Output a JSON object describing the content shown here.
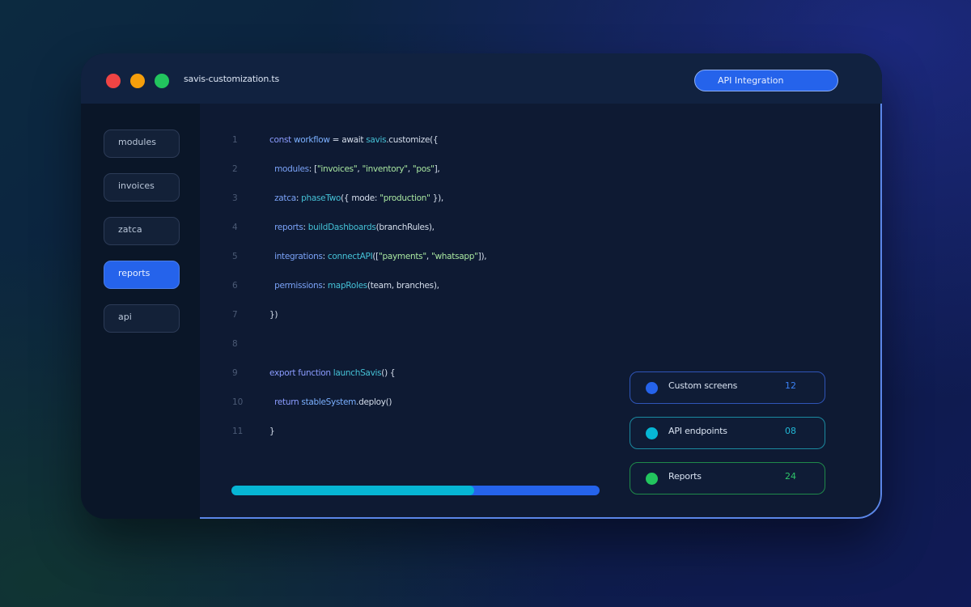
{
  "window": {
    "filename": "savis-customization.ts",
    "header_button": "API Integration"
  },
  "sidebar": {
    "items": [
      {
        "label": "modules",
        "active": false
      },
      {
        "label": "invoices",
        "active": false
      },
      {
        "label": "zatca",
        "active": false
      },
      {
        "label": "reports",
        "active": true
      },
      {
        "label": "api",
        "active": false
      }
    ]
  },
  "editor": {
    "lines": [
      {
        "num": "1",
        "tokens": [
          {
            "t": "const ",
            "c": "kw"
          },
          {
            "t": "workflow",
            "c": "fn"
          },
          {
            "t": " = await ",
            "c": "plain"
          },
          {
            "t": "savis",
            "c": "obj"
          },
          {
            "t": ".customize",
            "c": "plain"
          },
          {
            "t": "({",
            "c": "plain"
          }
        ]
      },
      {
        "num": "2",
        "tokens": [
          {
            "t": "  modules",
            "c": "prop"
          },
          {
            "t": ": [",
            "c": "plain"
          },
          {
            "t": "\"invoices\"",
            "c": "str"
          },
          {
            "t": ", ",
            "c": "plain"
          },
          {
            "t": "\"inventory\"",
            "c": "str"
          },
          {
            "t": ", ",
            "c": "plain"
          },
          {
            "t": "\"pos\"",
            "c": "str"
          },
          {
            "t": "],",
            "c": "plain"
          }
        ]
      },
      {
        "num": "3",
        "tokens": [
          {
            "t": "  zatca",
            "c": "prop"
          },
          {
            "t": ": ",
            "c": "plain"
          },
          {
            "t": "phaseTwo",
            "c": "obj"
          },
          {
            "t": "({ mode: ",
            "c": "plain"
          },
          {
            "t": "\"production\"",
            "c": "str"
          },
          {
            "t": " }),",
            "c": "plain"
          }
        ]
      },
      {
        "num": "4",
        "tokens": [
          {
            "t": "  reports",
            "c": "prop"
          },
          {
            "t": ": ",
            "c": "plain"
          },
          {
            "t": "buildDashboards",
            "c": "obj"
          },
          {
            "t": "(branchRules),",
            "c": "plain"
          }
        ]
      },
      {
        "num": "5",
        "tokens": [
          {
            "t": "  integrations",
            "c": "prop"
          },
          {
            "t": ": ",
            "c": "plain"
          },
          {
            "t": "connectAPI",
            "c": "obj"
          },
          {
            "t": "([",
            "c": "plain"
          },
          {
            "t": "\"payments\"",
            "c": "str"
          },
          {
            "t": ", ",
            "c": "plain"
          },
          {
            "t": "\"whatsapp\"",
            "c": "str"
          },
          {
            "t": "]),",
            "c": "plain"
          }
        ]
      },
      {
        "num": "6",
        "tokens": [
          {
            "t": "  permissions",
            "c": "prop"
          },
          {
            "t": ": ",
            "c": "plain"
          },
          {
            "t": "mapRoles",
            "c": "obj"
          },
          {
            "t": "(team, branches),",
            "c": "plain"
          }
        ]
      },
      {
        "num": "7",
        "tokens": [
          {
            "t": "})",
            "c": "plain"
          }
        ]
      },
      {
        "num": "8",
        "tokens": []
      },
      {
        "num": "9",
        "tokens": [
          {
            "t": "export function ",
            "c": "kw"
          },
          {
            "t": "launchSavis",
            "c": "obj"
          },
          {
            "t": "() {",
            "c": "plain"
          }
        ]
      },
      {
        "num": "10",
        "tokens": [
          {
            "t": "  return ",
            "c": "kw"
          },
          {
            "t": "stableSystem",
            "c": "fn"
          },
          {
            "t": ".deploy()",
            "c": "plain"
          }
        ]
      },
      {
        "num": "11",
        "tokens": [
          {
            "t": "}",
            "c": "plain"
          }
        ]
      }
    ]
  },
  "progress": {
    "fraction": 0.66,
    "fill_color": "#06b6d4",
    "track_color": "#2563eb"
  },
  "stats": [
    {
      "label": "Custom screens",
      "value": "12",
      "color": "#2563eb",
      "border": "#2f55b8",
      "value_color": "#3b82f6"
    },
    {
      "label": "API endpoints",
      "value": "08",
      "color": "#06b6d4",
      "border": "#1b8aa0",
      "value_color": "#22b8d6"
    },
    {
      "label": "Reports",
      "value": "24",
      "color": "#22c55e",
      "border": "#1f8a4a",
      "value_color": "#2fc56a"
    }
  ],
  "colors": {
    "accent": "#2563eb",
    "cyan": "#06b6d4",
    "green": "#22c55e",
    "red": "#ef4444",
    "yellow": "#f59e0b"
  }
}
